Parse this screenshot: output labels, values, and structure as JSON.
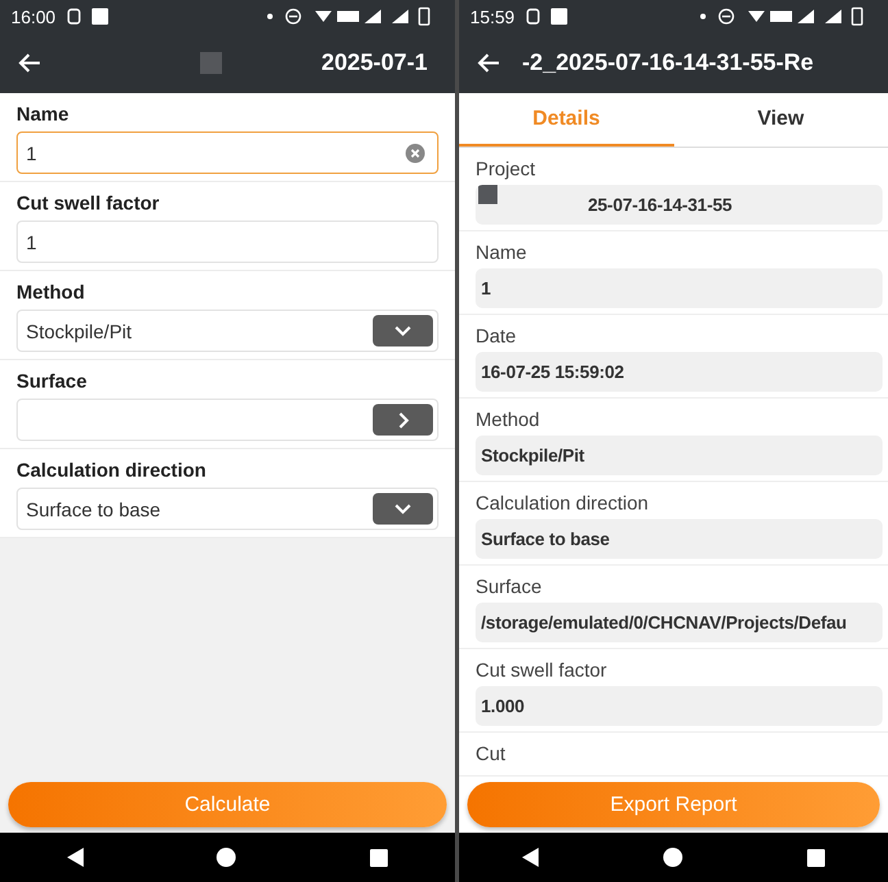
{
  "edit_screen": {
    "status_bar": {
      "time": "16:00"
    },
    "app_bar": {
      "title": "2025-07-1"
    },
    "fields": [
      {
        "label": "Name",
        "kind": "text",
        "value": "1",
        "focused": true
      },
      {
        "label": "Cut swell factor",
        "kind": "text",
        "value": "1",
        "focused": false
      },
      {
        "label": "Method",
        "kind": "dropdown",
        "value": "Stockpile/Pit",
        "focused": false
      },
      {
        "label": "Surface",
        "kind": "picker",
        "focused": false
      },
      {
        "label": "Calculation direction",
        "kind": "dropdown",
        "value": "Surface to base",
        "focused": false
      }
    ],
    "action_button": "Calculate"
  },
  "report_screen": {
    "status_bar": {
      "time": "15:59"
    },
    "app_bar": {
      "title": "-2_2025-07-16-14-31-55-Re"
    },
    "tabs": [
      {
        "label": "Details",
        "selected": true
      },
      {
        "label": "View",
        "selected": false
      }
    ],
    "fields": [
      {
        "label": "Project",
        "value": "25-07-16-14-31-55"
      },
      {
        "label": "Name",
        "value": "1"
      },
      {
        "label": "Date",
        "value": "16-07-25 15:59:02"
      },
      {
        "label": "Method",
        "value": "Stockpile/Pit"
      },
      {
        "label": "Calculation direction",
        "value": "Surface to base"
      },
      {
        "label": "Surface",
        "value": "/storage/emulated/0/CHCNAV/Projects/Defau"
      },
      {
        "label": "Cut swell factor",
        "value": "1.000"
      },
      {
        "label": "Cut"
      }
    ],
    "action_button": "Export Report"
  }
}
